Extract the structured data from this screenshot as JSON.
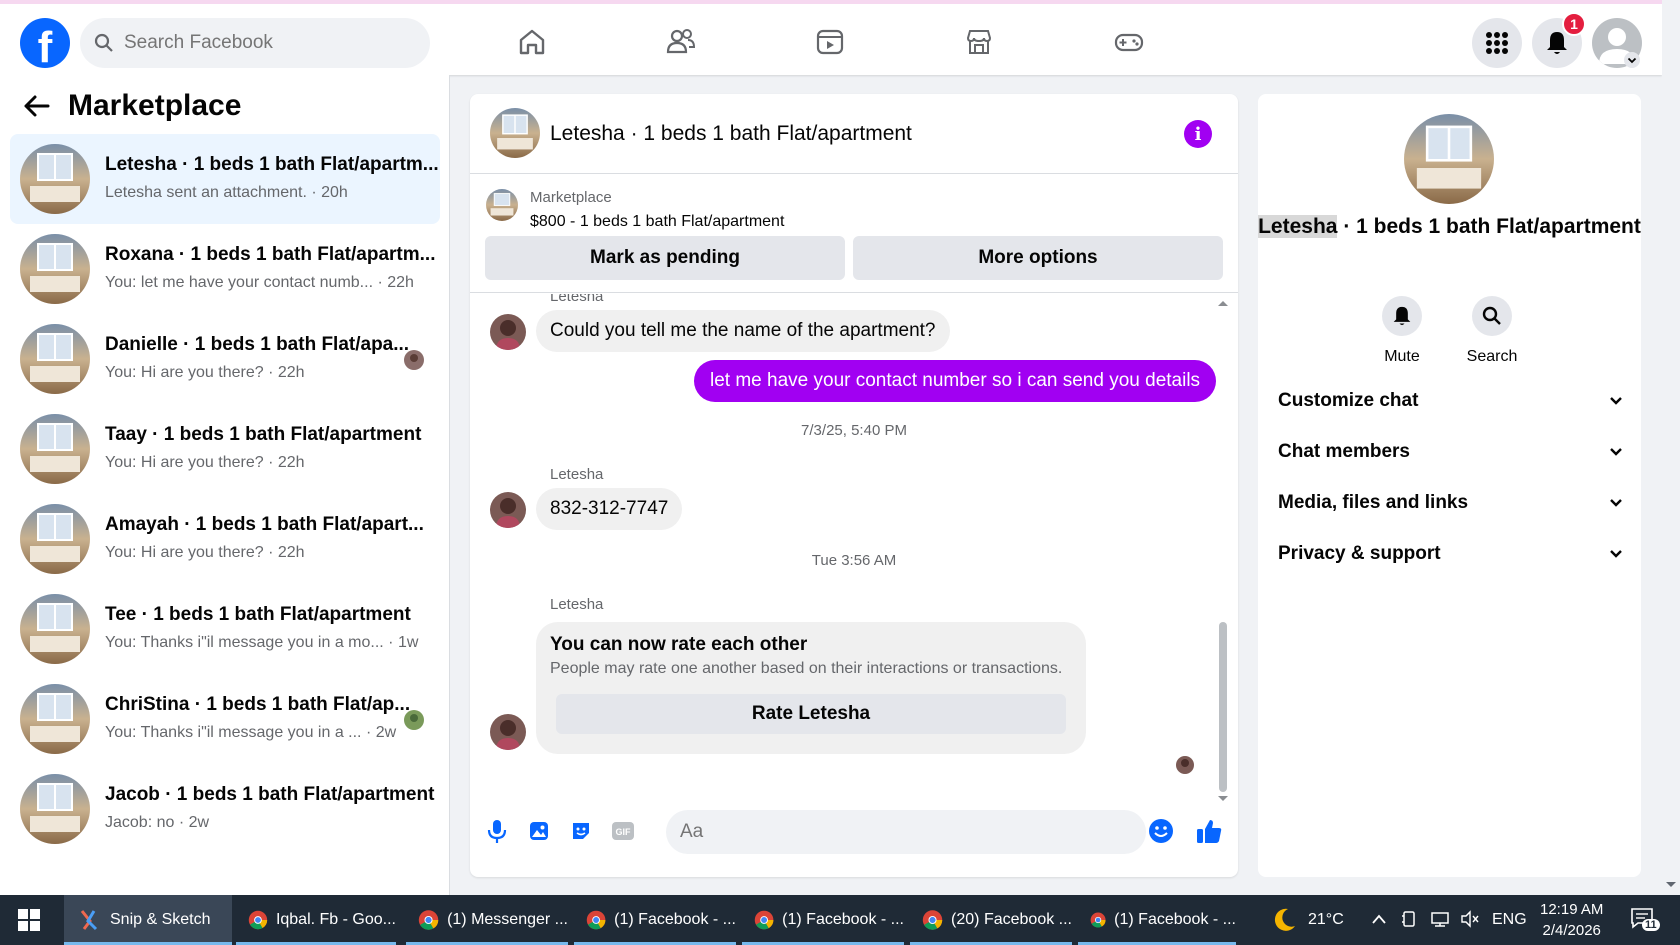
{
  "topnav": {
    "search_placeholder": "Search Facebook",
    "notifications_count": "1",
    "nav_icons": [
      "home-icon",
      "friends-icon",
      "video-icon",
      "marketplace-icon",
      "gaming-icon"
    ]
  },
  "sidebar": {
    "title": "Marketplace",
    "conversations": [
      {
        "title": "Letesha · 1 beds 1 bath Flat/apartm...",
        "sub": "Letesha sent an attachment. · 20h",
        "active": true
      },
      {
        "title": "Roxana · 1 beds 1 bath Flat/apartm...",
        "sub": "You: let me have your contact numb... · 22h"
      },
      {
        "title": "Danielle · 1 beds 1 bath Flat/apa...",
        "sub": "You: Hi are you there? · 22h"
      },
      {
        "title": "Taay · 1 beds 1 bath Flat/apartment",
        "sub": "You: Hi are you there? · 22h"
      },
      {
        "title": "Amayah · 1 beds 1 bath Flat/apart...",
        "sub": "You: Hi are you there? · 22h"
      },
      {
        "title": "Tee · 1 beds 1 bath Flat/apartment",
        "sub": "You: Thanks i\"il message you in a mo... · 1w"
      },
      {
        "title": "ChriStina · 1 beds 1 bath Flat/ap...",
        "sub": "You: Thanks i\"il message you in a ... · 2w"
      },
      {
        "title": "Jacob · 1 beds 1 bath Flat/apartment",
        "sub": "Jacob: no · 2w"
      }
    ]
  },
  "chat": {
    "title": "Letesha · 1 beds 1 bath Flat/apartment",
    "listing_source": "Marketplace",
    "listing_price": "$800 - 1 beds 1 bath Flat/apartment",
    "mark_pending": "Mark as pending",
    "more_options": "More options",
    "sender_name": "Letesha",
    "msg1": "Could you tell me the name of the apartment?",
    "msg2": "let me have your contact number so i can send you details",
    "ts1": "7/3/25, 5:40 PM",
    "msg3": "832-312-7747",
    "ts2": "Tue 3:56 AM",
    "rate_title": "You can now rate each other",
    "rate_sub": "People may rate one another based on their interactions or transactions.",
    "rate_button": "Rate Letesha",
    "composer_placeholder": "Aa"
  },
  "rpanel": {
    "name_highlight": "Letesha",
    "name_rest": " · 1 beds 1 bath Flat/apartment",
    "mute": "Mute",
    "search": "Search",
    "sections": [
      "Customize chat",
      "Chat members",
      "Media, files and links",
      "Privacy & support"
    ]
  },
  "taskbar": {
    "items": [
      {
        "label": "Snip & Sketch"
      },
      {
        "label": "Iqbal. Fb - Goo..."
      },
      {
        "label": "(1) Messenger ..."
      },
      {
        "label": "(1) Facebook - ..."
      },
      {
        "label": "(1) Facebook - ..."
      },
      {
        "label": "(20) Facebook ..."
      },
      {
        "label": "(1) Facebook - ..."
      }
    ],
    "weather": "21°C",
    "lang": "ENG",
    "time": "12:19 AM",
    "date": "2/4/2026",
    "notif_count": "11"
  },
  "colors": {
    "brand_blue": "#0866ff",
    "messenger_purple": "#a100f2",
    "active_bg": "#ebf5ff",
    "taskbar": "#1f2a36"
  }
}
